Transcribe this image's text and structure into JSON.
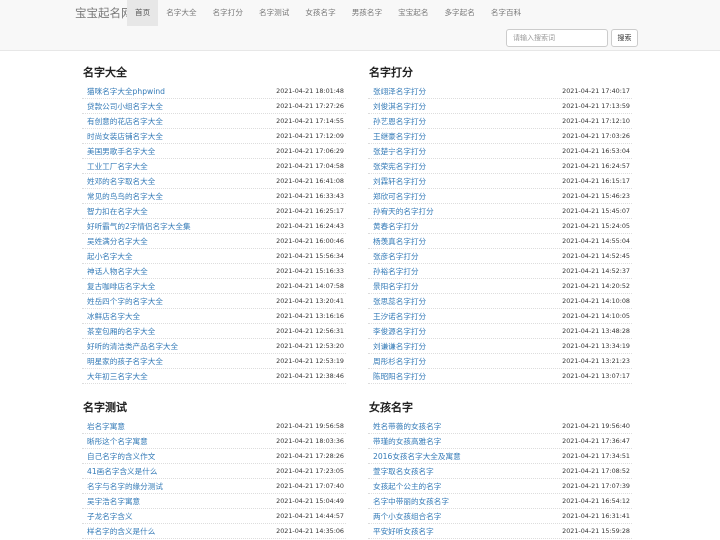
{
  "brand": "宝宝起名网",
  "nav": [
    "首页",
    "名字大全",
    "名字打分",
    "名字测试",
    "女孩名字",
    "男孩名字",
    "宝宝起名",
    "多字起名",
    "名字百科"
  ],
  "search": {
    "placeholder": "请输入搜索词",
    "button": "搜索"
  },
  "sections": [
    {
      "title": "名字大全",
      "items": [
        {
          "title": "猫咪名字大全phpwind",
          "date": "2021-04-21 18:01:48"
        },
        {
          "title": "贷款公司小组名字大全",
          "date": "2021-04-21 17:27:26"
        },
        {
          "title": "有创意的花店名字大全",
          "date": "2021-04-21 17:14:55"
        },
        {
          "title": "时尚女装店铺名字大全",
          "date": "2021-04-21 17:12:09"
        },
        {
          "title": "美国男歌手名字大全",
          "date": "2021-04-21 17:06:29"
        },
        {
          "title": "工业工厂名字大全",
          "date": "2021-04-21 17:04:58"
        },
        {
          "title": "姓邓的名字取名大全",
          "date": "2021-04-21 16:41:08"
        },
        {
          "title": "常见的鸟鸟的名字大全",
          "date": "2021-04-21 16:33:43"
        },
        {
          "title": "智力扣在名字大全",
          "date": "2021-04-21 16:25:17"
        },
        {
          "title": "好听霸气的2字情侣名字大全集",
          "date": "2021-04-21 16:24:43"
        },
        {
          "title": "吴姓满分名字大全",
          "date": "2021-04-21 16:00:46"
        },
        {
          "title": "起小名字大全",
          "date": "2021-04-21 15:56:34"
        },
        {
          "title": "神话人物名字大全",
          "date": "2021-04-21 15:16:33"
        },
        {
          "title": "复古咖啡店名字大全",
          "date": "2021-04-21 14:07:58"
        },
        {
          "title": "姓岳四个字的名字大全",
          "date": "2021-04-21 13:20:41"
        },
        {
          "title": "冰鲜店名字大全",
          "date": "2021-04-21 13:16:16"
        },
        {
          "title": "茶室包厢的名字大全",
          "date": "2021-04-21 12:56:31"
        },
        {
          "title": "好听的清洁类产品名字大全",
          "date": "2021-04-21 12:53:20"
        },
        {
          "title": "明星家的孩子名字大全",
          "date": "2021-04-21 12:53:19"
        },
        {
          "title": "大年初三名字大全",
          "date": "2021-04-21 12:38:46"
        }
      ]
    },
    {
      "title": "名字打分",
      "items": [
        {
          "title": "张翊泽名字打分",
          "date": "2021-04-21 17:40:17"
        },
        {
          "title": "刘俊淇名字打分",
          "date": "2021-04-21 17:13:59"
        },
        {
          "title": "孙艺恩名字打分",
          "date": "2021-04-21 17:12:10"
        },
        {
          "title": "王继豪名字打分",
          "date": "2021-04-21 17:03:26"
        },
        {
          "title": "张楚宁名字打分",
          "date": "2021-04-21 16:53:04"
        },
        {
          "title": "张荣宪名字打分",
          "date": "2021-04-21 16:24:57"
        },
        {
          "title": "刘霖轩名字打分",
          "date": "2021-04-21 16:15:17"
        },
        {
          "title": "郑欣可名字打分",
          "date": "2021-04-21 15:46:23"
        },
        {
          "title": "孙宥天的名字打分",
          "date": "2021-04-21 15:45:07"
        },
        {
          "title": "黄春名字打分",
          "date": "2021-04-21 15:24:05"
        },
        {
          "title": "杨羡真名字打分",
          "date": "2021-04-21 14:55:04"
        },
        {
          "title": "张彦名字打分",
          "date": "2021-04-21 14:52:45"
        },
        {
          "title": "孙裕名字打分",
          "date": "2021-04-21 14:52:37"
        },
        {
          "title": "景阳名字打分",
          "date": "2021-04-21 14:20:52"
        },
        {
          "title": "张思蕊名字打分",
          "date": "2021-04-21 14:10:08"
        },
        {
          "title": "王汐诺名字打分",
          "date": "2021-04-21 14:10:05"
        },
        {
          "title": "李俊源名字打分",
          "date": "2021-04-21 13:48:28"
        },
        {
          "title": "刘谦谦名字打分",
          "date": "2021-04-21 13:34:19"
        },
        {
          "title": "周彤杉名字打分",
          "date": "2021-04-21 13:21:23"
        },
        {
          "title": "陈昭阳名字打分",
          "date": "2021-04-21 13:07:17"
        }
      ]
    },
    {
      "title": "名字测试",
      "items": [
        {
          "title": "岩名字寓意",
          "date": "2021-04-21 19:56:58"
        },
        {
          "title": "晰彤这个名字寓意",
          "date": "2021-04-21 18:03:36"
        },
        {
          "title": "自己名字的含义作文",
          "date": "2021-04-21 17:28:26"
        },
        {
          "title": "41画名字含义是什么",
          "date": "2021-04-21 17:23:05"
        },
        {
          "title": "名字与名字的缘分测试",
          "date": "2021-04-21 17:07:40"
        },
        {
          "title": "吴宇浩名字寓意",
          "date": "2021-04-21 15:04:49"
        },
        {
          "title": "子龙名字含义",
          "date": "2021-04-21 14:44:57"
        },
        {
          "title": "样名字的含义是什么",
          "date": "2021-04-21 14:35:06"
        }
      ]
    },
    {
      "title": "女孩名字",
      "items": [
        {
          "title": "姓名带薇的女孩名字",
          "date": "2021-04-21 19:56:40"
        },
        {
          "title": "带瑾的女孩高雅名字",
          "date": "2021-04-21 17:36:47"
        },
        {
          "title": "2016女孩名字大全及寓意",
          "date": "2021-04-21 17:34:51"
        },
        {
          "title": "萱字取名女孩名字",
          "date": "2021-04-21 17:08:52"
        },
        {
          "title": "女孩起个公主的名字",
          "date": "2021-04-21 17:07:39"
        },
        {
          "title": "名字中带丽的女孩名字",
          "date": "2021-04-21 16:54:12"
        },
        {
          "title": "两个小女孩组合名字",
          "date": "2021-04-21 16:31:41"
        },
        {
          "title": "平安好听女孩名字",
          "date": "2021-04-21 15:59:28"
        }
      ]
    }
  ]
}
